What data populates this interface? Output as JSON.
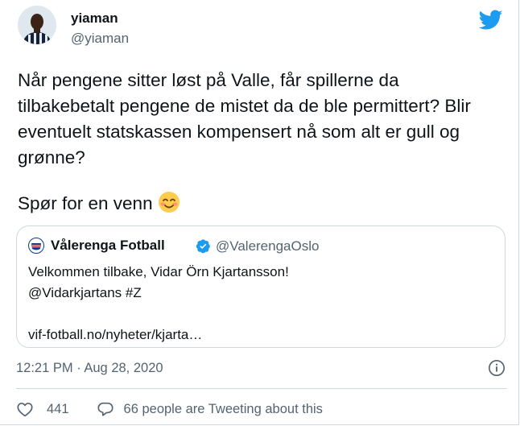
{
  "tweet": {
    "author_name": "yiaman",
    "author_handle": "@yiaman",
    "text": "Når pengene sitter løst på Valle, får spillerne da\ntilbakebetalt pengene de mistet da de ble permittert? Blir\neventuelt statskassen kompensert nå som alt er gull og\ngrønne?",
    "text2": "Spør for en venn",
    "emoji_icon": "smiling-face-icon",
    "timestamp": "12:21 PM · Aug 28, 2020"
  },
  "quoted_tweet": {
    "author_name": "Vålerenga Fotball",
    "author_handle": "@ValerengaOslo",
    "text": "Velkommen tilbake, Vidar Örn Kjartansson!\n@Vidarkjartans #Z\n\nvif-fotball.no/nyheter/kjarta…"
  },
  "actions": {
    "like_count": "441",
    "tweeting_label": "66 people are Tweeting about this"
  },
  "colors": {
    "twitter_blue": "#1d9bf0",
    "secondary_text": "#536471",
    "border": "#cfd9de",
    "vif_blue": "#0a3b8c"
  }
}
